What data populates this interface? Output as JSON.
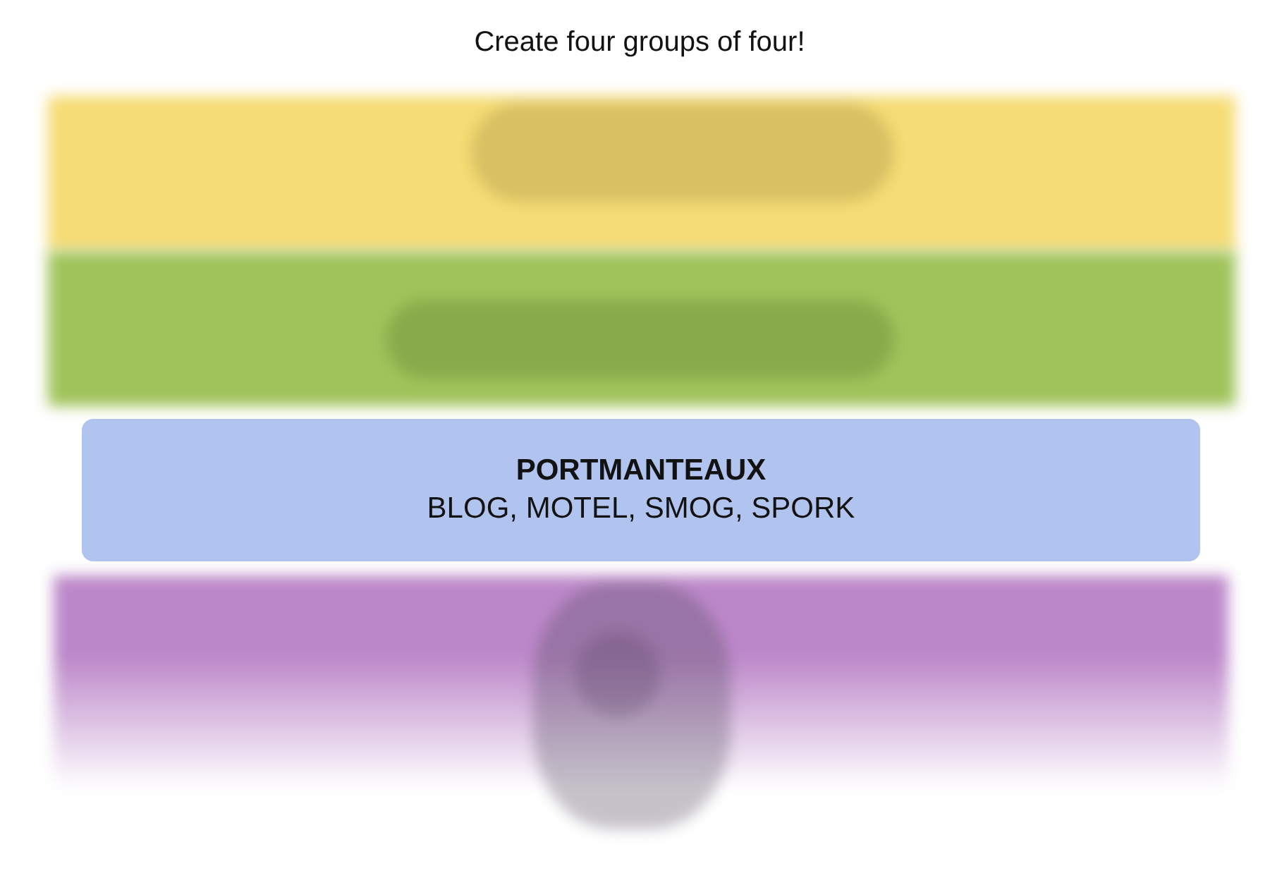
{
  "heading": "Create four groups of four!",
  "groups": [
    {
      "kind": "obscured",
      "color": "#f6dc74"
    },
    {
      "kind": "obscured",
      "color": "#a0c35a"
    },
    {
      "kind": "solved",
      "color": "#b0c4ef",
      "title": "PORTMANTEAUX",
      "words": "BLOG, MOTEL, SMOG, SPORK"
    },
    {
      "kind": "obscured",
      "color": "#bc87c9"
    }
  ]
}
